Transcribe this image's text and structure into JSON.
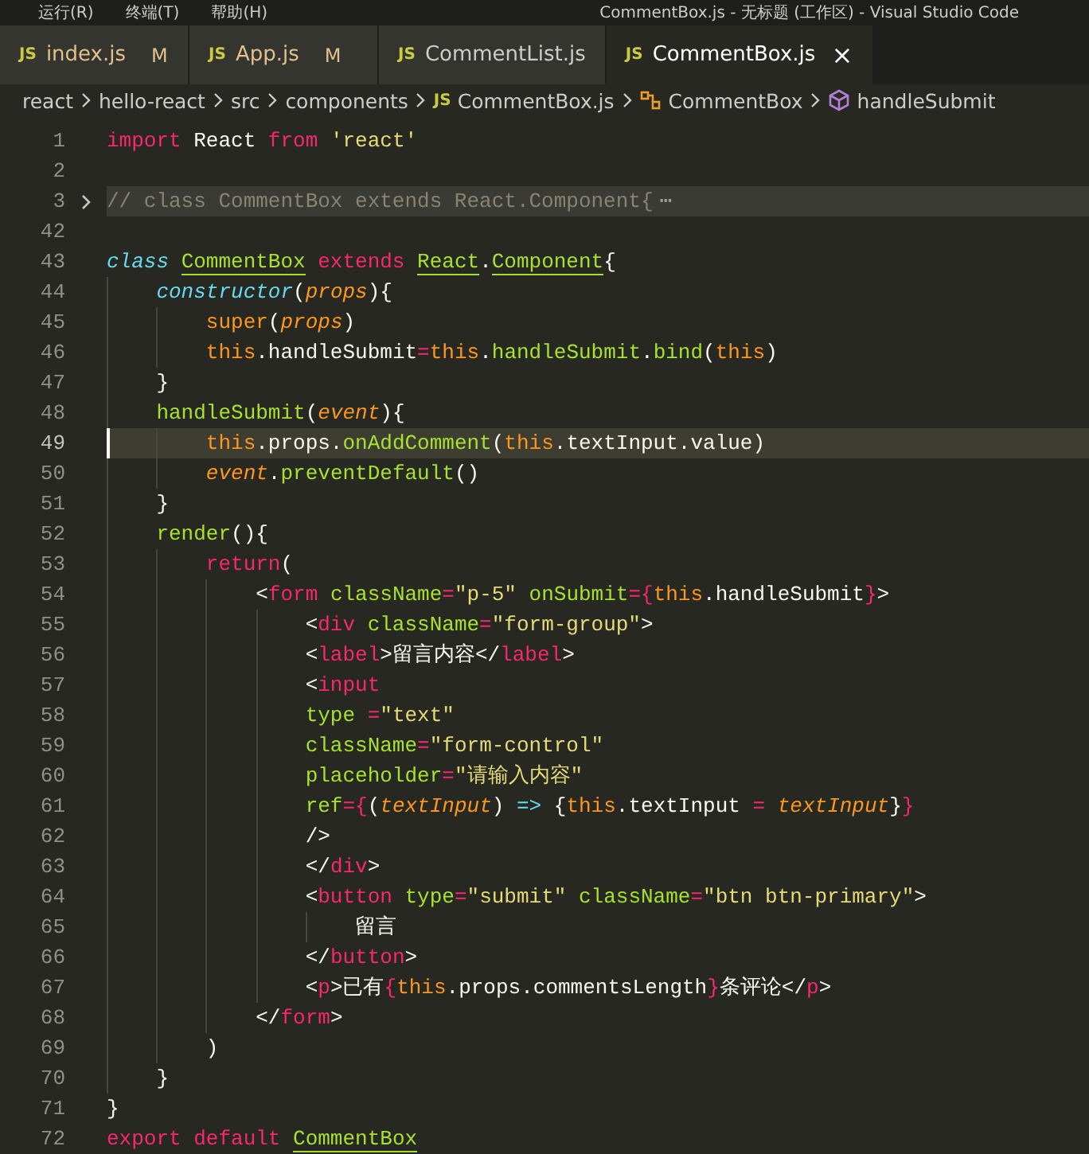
{
  "title_bar": {
    "menu": [
      "运行(R)",
      "终端(T)",
      "帮助(H)"
    ],
    "title": "CommentBox.js - 无标题 (工作区) - Visual Studio Code"
  },
  "tabs": [
    {
      "icon": "JS",
      "label": "index.js",
      "badge": "M",
      "selected": false
    },
    {
      "icon": "JS",
      "label": "App.js",
      "badge": "M",
      "selected": false
    },
    {
      "icon": "JS",
      "label": "CommentList.js",
      "selected": false
    },
    {
      "icon": "JS",
      "label": "CommentBox.js",
      "selected": true,
      "close": "×"
    }
  ],
  "breadcrumbs": [
    {
      "kind": "folder",
      "label": "react"
    },
    {
      "kind": "folder",
      "label": "hello-react"
    },
    {
      "kind": "folder",
      "label": "src"
    },
    {
      "kind": "folder",
      "label": "components"
    },
    {
      "kind": "file",
      "icon": "JS",
      "label": "CommentBox.js"
    },
    {
      "kind": "class",
      "label": "CommentBox"
    },
    {
      "kind": "method",
      "label": "handleSubmit"
    }
  ],
  "lines": [
    {
      "num": "1",
      "folded": false,
      "current": false,
      "tokens": [
        {
          "kind": "kw",
          "text": "import"
        },
        {
          "kind": "pl",
          "text": " React "
        },
        {
          "kind": "kw",
          "text": "from"
        },
        {
          "kind": "str",
          "text": " 'react'"
        }
      ]
    },
    {
      "num": "2",
      "folded": false,
      "current": false
    },
    {
      "num": "3",
      "folded": true,
      "current": false,
      "tokens": [
        {
          "kind": "cm",
          "text": "// class CommentBox extends React.Component{"
        },
        {
          "kind": "ell",
          "text": "⋯"
        }
      ]
    },
    {
      "num": "42",
      "folded": false,
      "current": false
    },
    {
      "num": "43",
      "folded": false,
      "current": false,
      "tokens": [
        {
          "kind": "st",
          "text": "class "
        },
        {
          "kind": "cls",
          "text": "CommentBox"
        },
        {
          "kind": "kw",
          "text": " extends "
        },
        {
          "kind": "cls",
          "text": "React"
        },
        {
          "kind": "pl",
          "text": "."
        },
        {
          "kind": "cls",
          "text": "Component"
        },
        {
          "kind": "pl",
          "text": "{"
        }
      ]
    },
    {
      "num": "44",
      "folded": false,
      "current": false,
      "tokens": [
        {
          "kind": "st",
          "text": "    constructor"
        },
        {
          "kind": "pl",
          "text": "("
        },
        {
          "kind": "par",
          "text": "props"
        },
        {
          "kind": "pl",
          "text": "){"
        }
      ]
    },
    {
      "num": "45",
      "folded": false,
      "current": false,
      "tokens": [
        {
          "kind": "th",
          "text": "        super"
        },
        {
          "kind": "pl",
          "text": "("
        },
        {
          "kind": "par",
          "text": "props"
        },
        {
          "kind": "pl",
          "text": ")"
        }
      ]
    },
    {
      "num": "46",
      "folded": false,
      "current": false,
      "tokens": [
        {
          "kind": "th",
          "text": "        this"
        },
        {
          "kind": "pl",
          "text": ".handleSubmit"
        },
        {
          "kind": "kw",
          "text": "="
        },
        {
          "kind": "th",
          "text": "this"
        },
        {
          "kind": "pl",
          "text": "."
        },
        {
          "kind": "fn",
          "text": "handleSubmit"
        },
        {
          "kind": "pl",
          "text": "."
        },
        {
          "kind": "fn",
          "text": "bind"
        },
        {
          "kind": "pl",
          "text": "("
        },
        {
          "kind": "th",
          "text": "this"
        },
        {
          "kind": "pl",
          "text": ")"
        }
      ]
    },
    {
      "num": "47",
      "folded": false,
      "current": false,
      "tokens": [
        {
          "kind": "pl",
          "text": "    }"
        }
      ]
    },
    {
      "num": "48",
      "folded": false,
      "current": false,
      "tokens": [
        {
          "kind": "fn",
          "text": "    handleSubmit"
        },
        {
          "kind": "pl",
          "text": "("
        },
        {
          "kind": "par",
          "text": "event"
        },
        {
          "kind": "pl",
          "text": "){"
        }
      ]
    },
    {
      "num": "49",
      "folded": false,
      "current": true,
      "tokens": [
        {
          "kind": "th",
          "text": "        this"
        },
        {
          "kind": "pl",
          "text": ".props."
        },
        {
          "kind": "fn",
          "text": "onAddComment"
        },
        {
          "kind": "pl",
          "text": "("
        },
        {
          "kind": "th",
          "text": "this"
        },
        {
          "kind": "pl",
          "text": ".textInput.value)"
        }
      ]
    },
    {
      "num": "50",
      "folded": false,
      "current": false,
      "tokens": [
        {
          "kind": "par",
          "text": "        event"
        },
        {
          "kind": "pl",
          "text": "."
        },
        {
          "kind": "fn",
          "text": "preventDefault"
        },
        {
          "kind": "pl",
          "text": "()"
        }
      ]
    },
    {
      "num": "51",
      "folded": false,
      "current": false,
      "tokens": [
        {
          "kind": "pl",
          "text": "    }"
        }
      ]
    },
    {
      "num": "52",
      "folded": false,
      "current": false,
      "tokens": [
        {
          "kind": "fn",
          "text": "    render"
        },
        {
          "kind": "pl",
          "text": "(){"
        }
      ]
    },
    {
      "num": "53",
      "folded": false,
      "current": false,
      "tokens": [
        {
          "kind": "kw",
          "text": "        return"
        },
        {
          "kind": "pl",
          "text": "("
        }
      ]
    },
    {
      "num": "54",
      "folded": false,
      "current": false,
      "tokens": [
        {
          "kind": "pl",
          "text": "            <"
        },
        {
          "kind": "kw",
          "text": "form"
        },
        {
          "kind": "fn",
          "text": " className"
        },
        {
          "kind": "kw",
          "text": "="
        },
        {
          "kind": "str",
          "text": "\"p-5\""
        },
        {
          "kind": "fn",
          "text": " onSubmit"
        },
        {
          "kind": "kw",
          "text": "={"
        },
        {
          "kind": "th",
          "text": "this"
        },
        {
          "kind": "pl",
          "text": ".handleSubmit"
        },
        {
          "kind": "kw",
          "text": "}"
        },
        {
          "kind": "pl",
          "text": ">"
        }
      ]
    },
    {
      "num": "55",
      "folded": false,
      "current": false,
      "tokens": [
        {
          "kind": "pl",
          "text": "                <"
        },
        {
          "kind": "kw",
          "text": "div"
        },
        {
          "kind": "fn",
          "text": " className"
        },
        {
          "kind": "kw",
          "text": "="
        },
        {
          "kind": "str",
          "text": "\"form-group\""
        },
        {
          "kind": "pl",
          "text": ">"
        }
      ]
    },
    {
      "num": "56",
      "folded": false,
      "current": false,
      "tokens": [
        {
          "kind": "pl",
          "text": "                <"
        },
        {
          "kind": "kw",
          "text": "label"
        },
        {
          "kind": "pl",
          "text": ">留言内容</"
        },
        {
          "kind": "kw",
          "text": "label"
        },
        {
          "kind": "pl",
          "text": ">"
        }
      ]
    },
    {
      "num": "57",
      "folded": false,
      "current": false,
      "tokens": [
        {
          "kind": "pl",
          "text": "                <"
        },
        {
          "kind": "kw",
          "text": "input"
        }
      ]
    },
    {
      "num": "58",
      "folded": false,
      "current": false,
      "tokens": [
        {
          "kind": "fn",
          "text": "                type"
        },
        {
          "kind": "kw",
          "text": " ="
        },
        {
          "kind": "str",
          "text": "\"text\""
        }
      ]
    },
    {
      "num": "59",
      "folded": false,
      "current": false,
      "tokens": [
        {
          "kind": "fn",
          "text": "                className"
        },
        {
          "kind": "kw",
          "text": "="
        },
        {
          "kind": "str",
          "text": "\"form-control\""
        }
      ]
    },
    {
      "num": "60",
      "folded": false,
      "current": false,
      "tokens": [
        {
          "kind": "fn",
          "text": "                placeholder"
        },
        {
          "kind": "kw",
          "text": "="
        },
        {
          "kind": "str",
          "text": "\"请输入内容\""
        }
      ]
    },
    {
      "num": "61",
      "folded": false,
      "current": false,
      "tokens": [
        {
          "kind": "fn",
          "text": "                ref"
        },
        {
          "kind": "kw",
          "text": "={"
        },
        {
          "kind": "pl",
          "text": "("
        },
        {
          "kind": "par",
          "text": "textInput"
        },
        {
          "kind": "pl",
          "text": ") "
        },
        {
          "kind": "st",
          "text": "=>"
        },
        {
          "kind": "pl",
          "text": " {"
        },
        {
          "kind": "th",
          "text": "this"
        },
        {
          "kind": "pl",
          "text": ".textInput "
        },
        {
          "kind": "kw",
          "text": "="
        },
        {
          "kind": "par",
          "text": " textInput"
        },
        {
          "kind": "pl",
          "text": "}"
        },
        {
          "kind": "kw",
          "text": "}"
        }
      ]
    },
    {
      "num": "62",
      "folded": false,
      "current": false,
      "tokens": [
        {
          "kind": "pl",
          "text": "                />"
        }
      ]
    },
    {
      "num": "63",
      "folded": false,
      "current": false,
      "tokens": [
        {
          "kind": "pl",
          "text": "                </"
        },
        {
          "kind": "kw",
          "text": "div"
        },
        {
          "kind": "pl",
          "text": ">"
        }
      ]
    },
    {
      "num": "64",
      "folded": false,
      "current": false,
      "tokens": [
        {
          "kind": "pl",
          "text": "                <"
        },
        {
          "kind": "kw",
          "text": "button"
        },
        {
          "kind": "fn",
          "text": " type"
        },
        {
          "kind": "kw",
          "text": "="
        },
        {
          "kind": "str",
          "text": "\"submit\""
        },
        {
          "kind": "fn",
          "text": " className"
        },
        {
          "kind": "kw",
          "text": "="
        },
        {
          "kind": "str",
          "text": "\"btn btn-primary\""
        },
        {
          "kind": "pl",
          "text": ">"
        }
      ]
    },
    {
      "num": "65",
      "folded": false,
      "current": false,
      "tokens": [
        {
          "kind": "pl",
          "text": "                    留言"
        }
      ]
    },
    {
      "num": "66",
      "folded": false,
      "current": false,
      "tokens": [
        {
          "kind": "pl",
          "text": "                </"
        },
        {
          "kind": "kw",
          "text": "button"
        },
        {
          "kind": "pl",
          "text": ">"
        }
      ]
    },
    {
      "num": "67",
      "folded": false,
      "current": false,
      "tokens": [
        {
          "kind": "pl",
          "text": "                <"
        },
        {
          "kind": "kw",
          "text": "p"
        },
        {
          "kind": "pl",
          "text": ">已有"
        },
        {
          "kind": "kw",
          "text": "{"
        },
        {
          "kind": "th",
          "text": "this"
        },
        {
          "kind": "pl",
          "text": ".props.commentsLength"
        },
        {
          "kind": "kw",
          "text": "}"
        },
        {
          "kind": "pl",
          "text": "条评论</"
        },
        {
          "kind": "kw",
          "text": "p"
        },
        {
          "kind": "pl",
          "text": ">"
        }
      ]
    },
    {
      "num": "68",
      "folded": false,
      "current": false,
      "tokens": [
        {
          "kind": "pl",
          "text": "            </"
        },
        {
          "kind": "kw",
          "text": "form"
        },
        {
          "kind": "pl",
          "text": ">"
        }
      ]
    },
    {
      "num": "69",
      "folded": false,
      "current": false,
      "tokens": [
        {
          "kind": "pl",
          "text": "        )"
        }
      ]
    },
    {
      "num": "70",
      "folded": false,
      "current": false,
      "tokens": [
        {
          "kind": "pl",
          "text": "    }"
        }
      ]
    },
    {
      "num": "71",
      "folded": false,
      "current": false,
      "tokens": [
        {
          "kind": "pl",
          "text": "}"
        }
      ]
    },
    {
      "num": "72",
      "folded": false,
      "current": false,
      "tokens": [
        {
          "kind": "kw",
          "text": "export default "
        },
        {
          "kind": "cls",
          "text": "CommentBox"
        }
      ]
    }
  ]
}
